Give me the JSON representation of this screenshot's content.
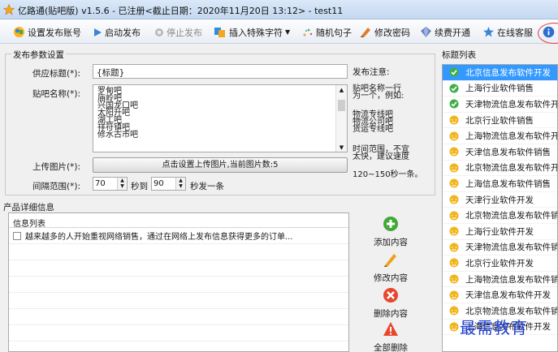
{
  "window": {
    "title": "亿路通(贴吧版) v1.5.6 - 已注册<截止日期：2020年11月20日 13:12> - test11"
  },
  "toolbar": {
    "set_account": "设置发布账号",
    "start": "启动发布",
    "stop": "停止发布",
    "insert_chars": "插入特殊字符",
    "random_sentence": "随机句子",
    "change_password": "修改密码",
    "renew": "续费开通",
    "support": "在线客服"
  },
  "settings": {
    "group_title": "发布参数设置",
    "supply_title_label": "供应标题(*):",
    "supply_title_value": "{标题}",
    "tieba_name_label": "贴吧名称(*):",
    "tieba_names": [
      "罗甸吧",
      "庙岭吧",
      "兴国龙口吧",
      "太阳升吧",
      "湖工吧",
      "祥符镇吧",
      "修水古市吧"
    ],
    "upload_image_label": "上传图片(*):",
    "upload_button": "点击设置上传图片,当前图片数:5",
    "interval_label": "间隔范围(*):",
    "interval_min": "70",
    "interval_to": "秒到",
    "interval_max": "90",
    "interval_unit": "秒发一条"
  },
  "notes": {
    "heading": "发布注意:",
    "lines1": [
      "贴吧名称一行",
      "为一个，例如:"
    ],
    "examples": [
      "物流专线吧",
      "物流公司吧",
      "货运专线吧"
    ],
    "lines2": [
      "时间范围，不宜",
      "太快，建议速度"
    ],
    "speed": "120~150秒一条。"
  },
  "details": {
    "group_title": "产品详细信息",
    "list_header": "信息列表",
    "rows": [
      "越来越多的人开始重视网络销售，通过在网络上发布信息获得更多的订单..."
    ]
  },
  "side_buttons": {
    "add": "添加内容",
    "edit": "修改内容",
    "delete": "删除内容",
    "delete_all": "全部删除"
  },
  "title_list": {
    "group_title": "标题列表",
    "items": [
      {
        "text": "北京信息发布软件开发",
        "status": "done"
      },
      {
        "text": "上海行业软件销售",
        "status": "done"
      },
      {
        "text": "天津物流信息发布软件开",
        "status": "done"
      },
      {
        "text": "北京行业软件销售",
        "status": "pending"
      },
      {
        "text": "上海物流信息发布软件开",
        "status": "pending"
      },
      {
        "text": "天津信息发布软件销售",
        "status": "pending"
      },
      {
        "text": "北京物流信息发布软件开",
        "status": "pending"
      },
      {
        "text": "上海信息发布软件销售",
        "status": "pending"
      },
      {
        "text": "天津行业软件开发",
        "status": "pending"
      },
      {
        "text": "北京物流信息发布软件销",
        "status": "pending"
      },
      {
        "text": "上海行业软件开发",
        "status": "pending"
      },
      {
        "text": "天津物流信息发布软件销",
        "status": "pending"
      },
      {
        "text": "北京行业软件开发",
        "status": "pending"
      },
      {
        "text": "上海物流信息发布软件销",
        "status": "pending"
      },
      {
        "text": "天津信息发布软件开发",
        "status": "pending"
      },
      {
        "text": "北京物流信息发布软件销",
        "status": "pending"
      },
      {
        "text": "上海信息发布软件开发",
        "status": "pending"
      }
    ]
  },
  "watermark": "最需教育",
  "colors": {
    "selection": "#3399ff",
    "done": "#3fae49",
    "pending": "#f1b51b",
    "delete": "#e8472e",
    "add": "#43a838"
  }
}
